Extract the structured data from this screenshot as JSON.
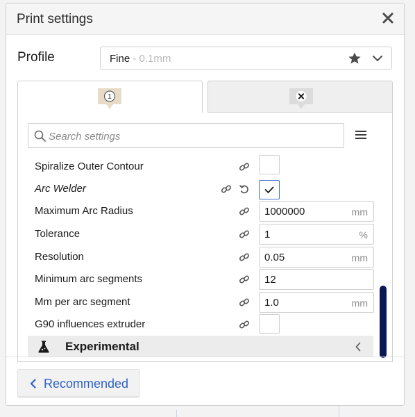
{
  "header": {
    "title": "Print settings"
  },
  "profile": {
    "label": "Profile",
    "value": "Fine",
    "sub": " - 0.1mm"
  },
  "tabs": [
    {
      "badge": "1"
    },
    {
      "badge": "×"
    }
  ],
  "search": {
    "placeholder": "Search settings"
  },
  "settings": [
    {
      "label": "Spiralize Outer Contour",
      "type": "checkbox",
      "checked": false
    },
    {
      "label": "Arc Welder",
      "type": "checkbox",
      "checked": true,
      "italic": true
    },
    {
      "label": "Maximum Arc Radius",
      "type": "field",
      "value": "1000000",
      "unit": "mm"
    },
    {
      "label": "Tolerance",
      "type": "field",
      "value": "1",
      "unit": "%"
    },
    {
      "label": "Resolution",
      "type": "field",
      "value": "0.05",
      "unit": "mm"
    },
    {
      "label": "Minimum arc segments",
      "type": "field",
      "value": "12",
      "unit": ""
    },
    {
      "label": "Mm per arc segment",
      "type": "field",
      "value": "1.0",
      "unit": "mm"
    },
    {
      "label": "G90 influences extruder",
      "type": "checkbox",
      "checked": false
    }
  ],
  "section": {
    "label": "Experimental"
  },
  "footer": {
    "recommended_label": "Recommended"
  },
  "colors": {
    "accent": "#2e63c4",
    "scrollbar": "#0b1654",
    "badge": "#e8dcc9"
  }
}
